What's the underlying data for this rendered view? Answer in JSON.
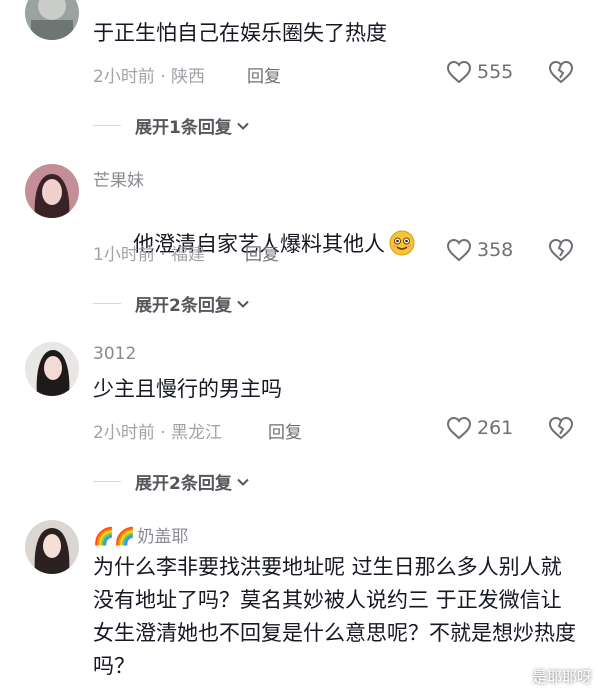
{
  "comments": [
    {
      "username": "",
      "text": "于正生怕自己在娱乐圈失了热度",
      "time_location": "2小时前 · 陕西",
      "reply_label": "回复",
      "likes": "555",
      "expand_label": "展开1条回复"
    },
    {
      "username": "芒果妹",
      "text": "他澄清自家艺人爆料其他人",
      "emoji": "smiling-face-emoji",
      "time_location": "1小时前 · 福建",
      "reply_label": "回复",
      "likes": "358",
      "expand_label": "展开2条回复"
    },
    {
      "username": "3012",
      "text": "少主且慢行的男主吗",
      "time_location": "2小时前 · 黑龙江",
      "reply_label": "回复",
      "likes": "261",
      "expand_label": "展开2条回复"
    },
    {
      "username": "奶盖耶",
      "username_prefix": "🌈🌈",
      "text": "为什么李非要找洪要地址呢 过生日那么多人别人就没有地址了吗？莫名其妙被人说约三 于正发微信让女生澄清她也不回复是什么意思呢？不就是想炒热度吗？"
    }
  ],
  "watermark": "是耶耶呀",
  "colors": {
    "text": "#161823",
    "meta": "#a2a3a8",
    "username": "#8a8b91",
    "expand": "#55565c"
  }
}
